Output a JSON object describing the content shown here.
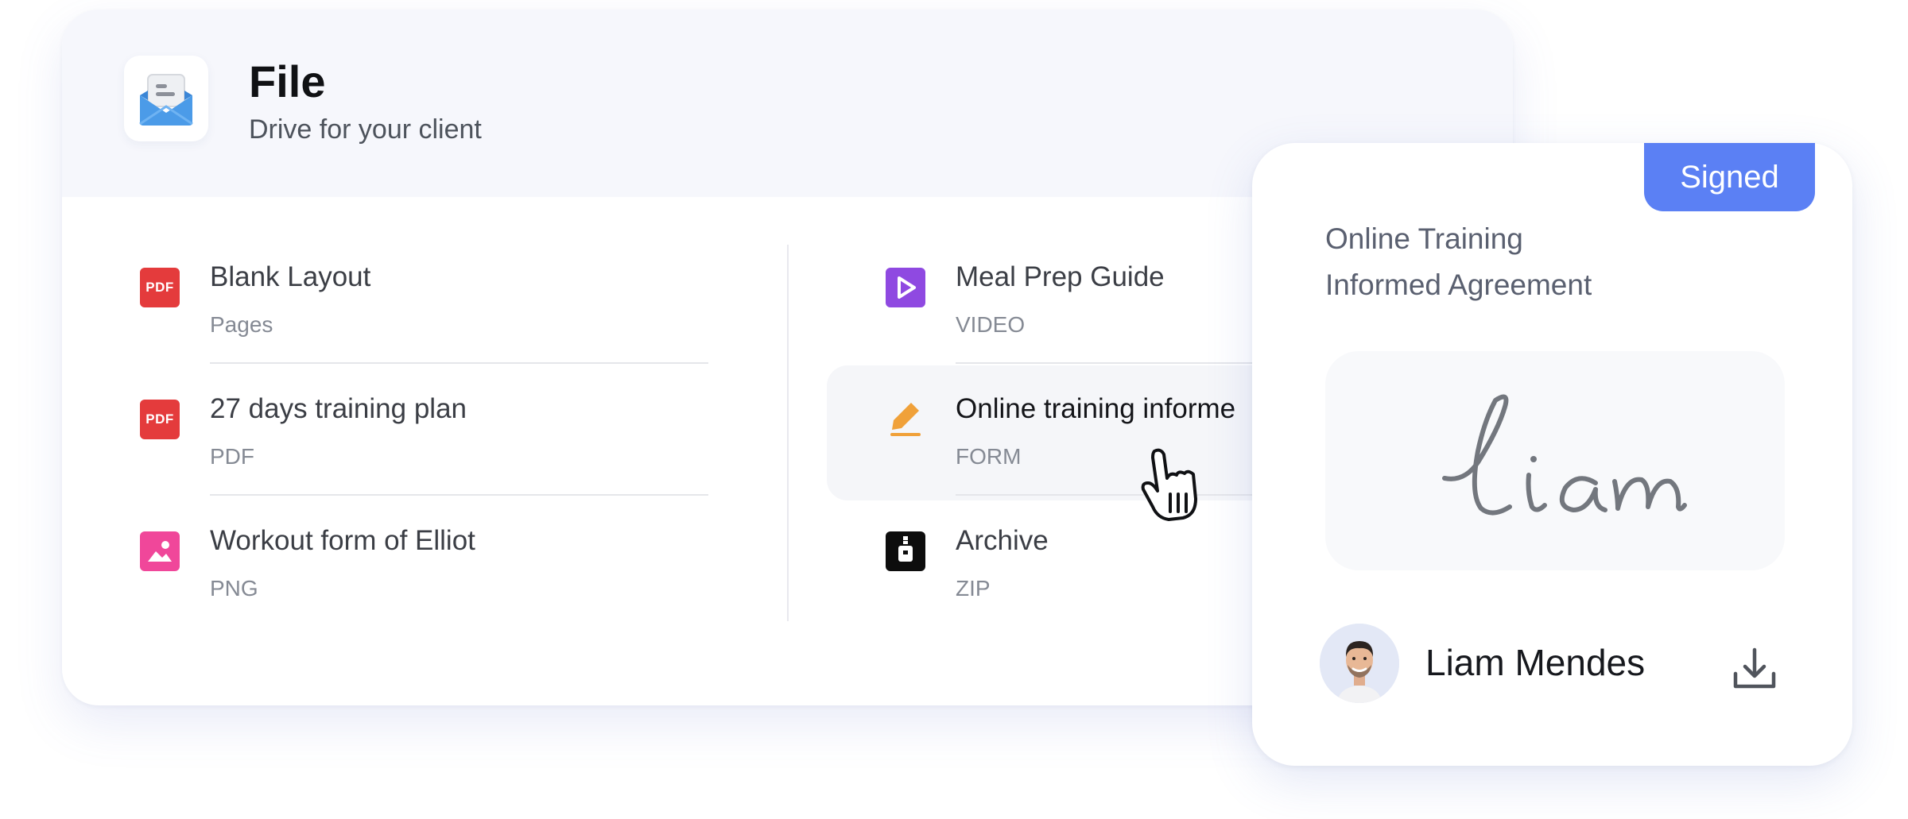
{
  "app": {
    "title": "File",
    "subtitle": "Drive for your client",
    "icon": "envelope-open-icon"
  },
  "files": {
    "left": [
      {
        "name": "Blank Layout",
        "type": "Pages",
        "icon": "pdf-icon",
        "badge": "PDF"
      },
      {
        "name": "27 days training plan",
        "type": "PDF",
        "icon": "pdf-icon",
        "badge": "PDF"
      },
      {
        "name": "Workout form of Elliot",
        "type": "PNG",
        "icon": "image-icon"
      }
    ],
    "right": [
      {
        "name": "Meal Prep Guide",
        "type": "VIDEO",
        "icon": "play-icon"
      },
      {
        "name": "Online training informe",
        "type": "FORM",
        "icon": "pen-icon"
      },
      {
        "name": "Archive",
        "type": "ZIP",
        "icon": "zip-icon"
      }
    ]
  },
  "signature_card": {
    "status": "Signed",
    "document_title_line1": "Online Training",
    "document_title_line2": "Informed Agreement",
    "signature_text": "liam",
    "signer_name": "Liam Mendes"
  },
  "colors": {
    "accent": "#5b80f4",
    "pdf": "#e43b3c",
    "video": "#8f49e1",
    "png": "#f0479a",
    "form": "#f0a13a",
    "zip": "#0d0d0d"
  }
}
